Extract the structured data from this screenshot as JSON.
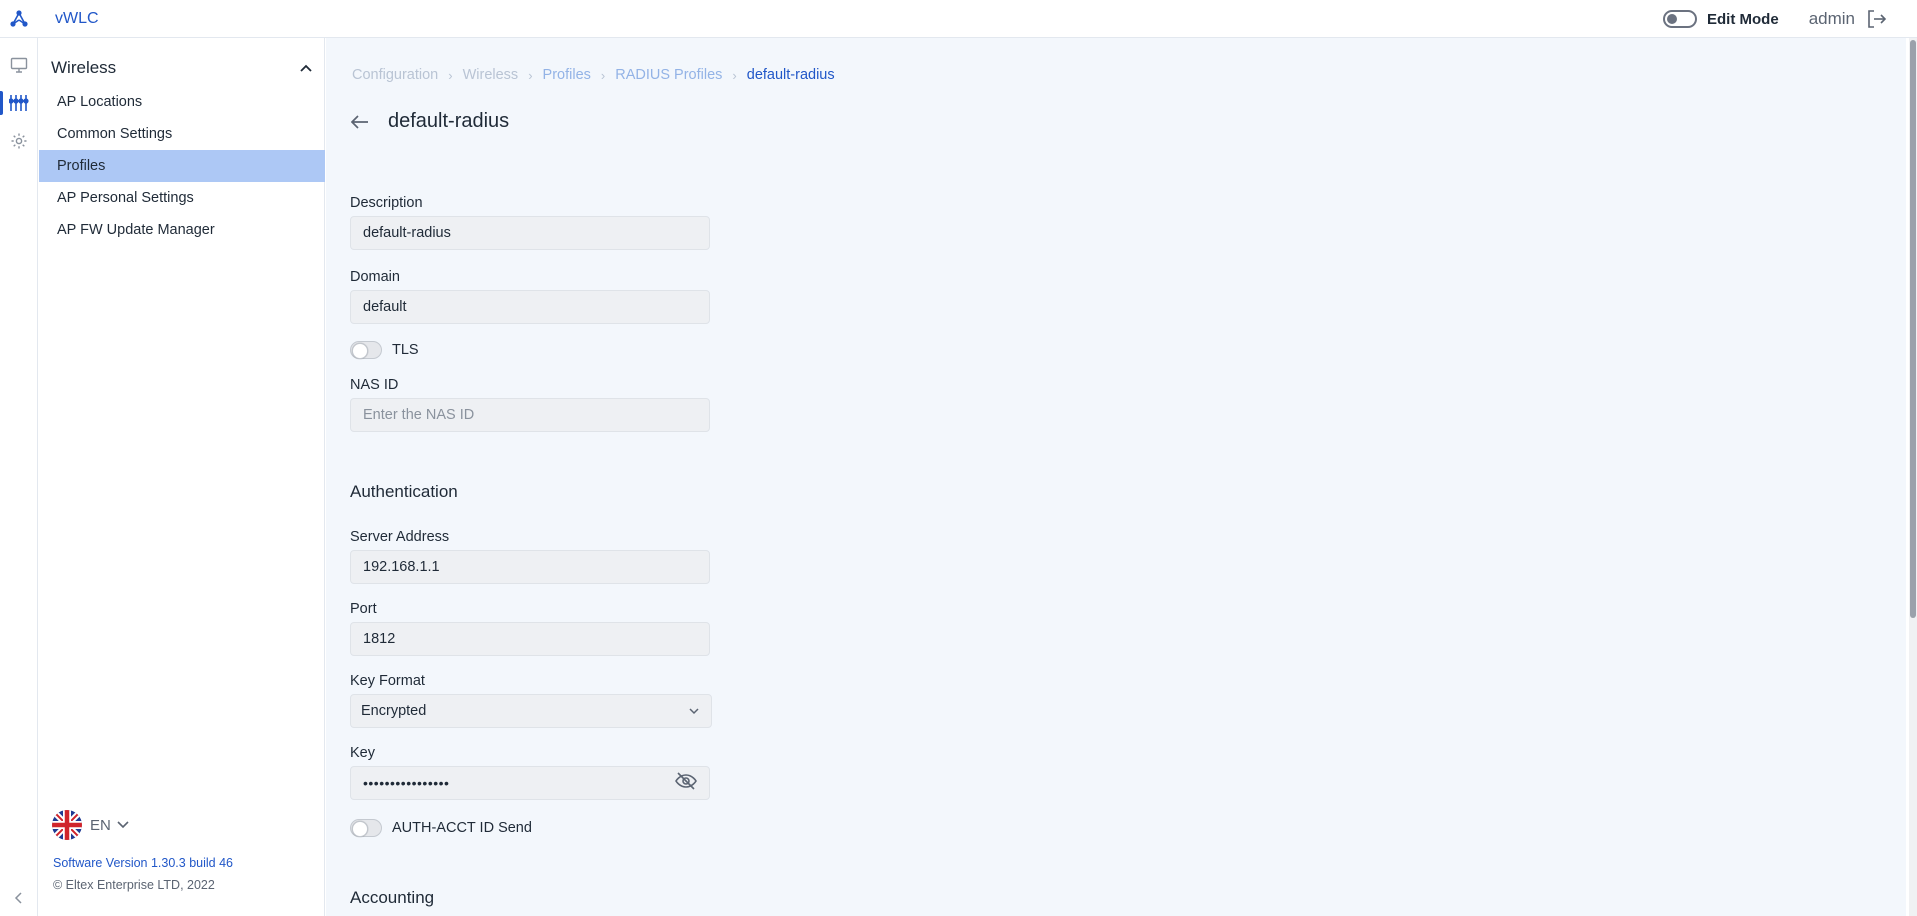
{
  "app": {
    "title": "vWLC"
  },
  "topbar": {
    "edit_mode_label": "Edit Mode",
    "user": "admin"
  },
  "sidebar": {
    "section_title": "Wireless",
    "items": [
      {
        "label": "AP Locations"
      },
      {
        "label": "Common Settings"
      },
      {
        "label": "Profiles",
        "active": true
      },
      {
        "label": "AP Personal Settings"
      },
      {
        "label": "AP FW Update Manager"
      }
    ],
    "language": "EN",
    "version": "Software Version 1.30.3 build 46",
    "copyright": "© Eltex Enterprise LTD, 2022"
  },
  "breadcrumb": [
    "Configuration",
    "Wireless",
    "Profiles",
    "RADIUS Profiles",
    "default-radius"
  ],
  "page": {
    "title": "default-radius"
  },
  "form": {
    "description": {
      "label": "Description",
      "value": "default-radius"
    },
    "domain": {
      "label": "Domain",
      "value": "default"
    },
    "tls": {
      "label": "TLS"
    },
    "nas_id": {
      "label": "NAS ID",
      "placeholder": "Enter the NAS ID"
    },
    "authentication": {
      "title": "Authentication",
      "server_address": {
        "label": "Server Address",
        "value": "192.168.1.1"
      },
      "port": {
        "label": "Port",
        "value": "1812"
      },
      "key_format": {
        "label": "Key Format",
        "value": "Encrypted"
      },
      "key": {
        "label": "Key",
        "masked": "••••••••••••••••"
      },
      "auth_acct": {
        "label": "AUTH-ACCT ID Send"
      }
    },
    "accounting": {
      "title": "Accounting"
    }
  },
  "colors": {
    "accent": "#2157c8",
    "active_item": "#adc8f5",
    "background": "#f3f7fc"
  }
}
